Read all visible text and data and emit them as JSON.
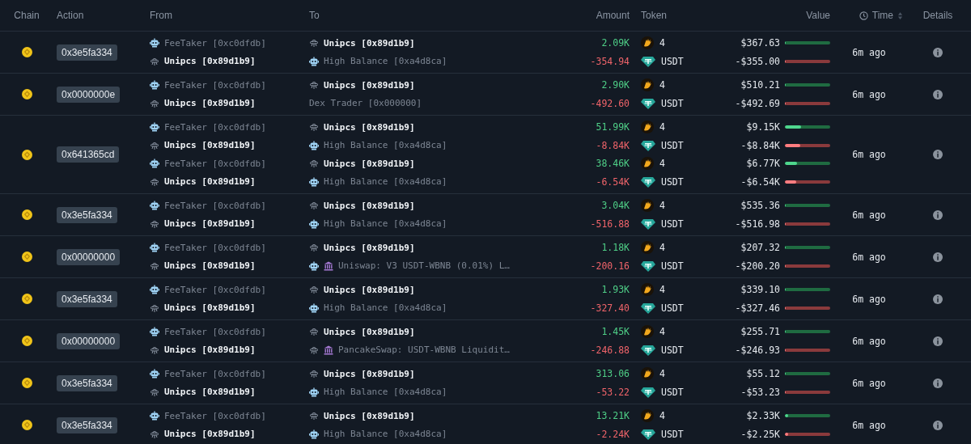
{
  "columns": [
    "Chain",
    "Action",
    "From",
    "To",
    "Amount",
    "Token",
    "Value",
    "Time",
    "Details"
  ],
  "rows": [
    {
      "action": "0x3e5fa334",
      "time": "6m ago",
      "transfers": [
        {
          "kind": "in",
          "from": {
            "kind": "bot",
            "contract": false,
            "highlight": false,
            "name": "FeeTaker [0xc0dfdb]"
          },
          "to": {
            "kind": "ufo",
            "contract": false,
            "highlight": true,
            "name": "Unipcs [0x89d1b9]"
          },
          "amount": "2.09K",
          "token": {
            "kind": "meme",
            "symbol": "4"
          },
          "value": "$367.63",
          "level": 0.01
        },
        {
          "kind": "out",
          "from": {
            "kind": "ufo",
            "contract": false,
            "highlight": true,
            "name": "Unipcs [0x89d1b9]"
          },
          "to": {
            "kind": "bot",
            "contract": false,
            "highlight": false,
            "name": "High Balance [0xa4d8ca]"
          },
          "amount": "-354.94",
          "token": {
            "kind": "usdt",
            "symbol": "USDT"
          },
          "value": "-$355.00",
          "level": 0.01
        }
      ]
    },
    {
      "action": "0x0000000e",
      "time": "6m ago",
      "transfers": [
        {
          "kind": "in",
          "from": {
            "kind": "bot",
            "contract": false,
            "highlight": false,
            "name": "FeeTaker [0xc0dfdb]"
          },
          "to": {
            "kind": "ufo",
            "contract": false,
            "highlight": true,
            "name": "Unipcs [0x89d1b9]"
          },
          "amount": "2.90K",
          "token": {
            "kind": "meme",
            "symbol": "4"
          },
          "value": "$510.21",
          "level": 0.02
        },
        {
          "kind": "out",
          "from": {
            "kind": "ufo",
            "contract": false,
            "highlight": true,
            "name": "Unipcs [0x89d1b9]"
          },
          "to": {
            "kind": "plain",
            "contract": false,
            "highlight": false,
            "name": "Dex Trader [0x000000]"
          },
          "amount": "-492.60",
          "token": {
            "kind": "usdt",
            "symbol": "USDT"
          },
          "value": "-$492.69",
          "level": 0.02
        }
      ]
    },
    {
      "action": "0x641365cd",
      "time": "6m ago",
      "transfers": [
        {
          "kind": "in",
          "from": {
            "kind": "bot",
            "contract": false,
            "highlight": false,
            "name": "FeeTaker [0xc0dfdb]"
          },
          "to": {
            "kind": "ufo",
            "contract": false,
            "highlight": true,
            "name": "Unipcs [0x89d1b9]"
          },
          "amount": "51.99K",
          "token": {
            "kind": "meme",
            "symbol": "4"
          },
          "value": "$9.15K",
          "level": 0.35
        },
        {
          "kind": "out",
          "from": {
            "kind": "ufo",
            "contract": false,
            "highlight": true,
            "name": "Unipcs [0x89d1b9]"
          },
          "to": {
            "kind": "bot",
            "contract": false,
            "highlight": false,
            "name": "High Balance [0xa4d8ca]"
          },
          "amount": "-8.84K",
          "token": {
            "kind": "usdt",
            "symbol": "USDT"
          },
          "value": "-$8.84K",
          "level": 0.34
        },
        {
          "kind": "in",
          "from": {
            "kind": "bot",
            "contract": false,
            "highlight": false,
            "name": "FeeTaker [0xc0dfdb]"
          },
          "to": {
            "kind": "ufo",
            "contract": false,
            "highlight": true,
            "name": "Unipcs [0x89d1b9]"
          },
          "amount": "38.46K",
          "token": {
            "kind": "meme",
            "symbol": "4"
          },
          "value": "$6.77K",
          "level": 0.26
        },
        {
          "kind": "out",
          "from": {
            "kind": "ufo",
            "contract": false,
            "highlight": true,
            "name": "Unipcs [0x89d1b9]"
          },
          "to": {
            "kind": "bot",
            "contract": false,
            "highlight": false,
            "name": "High Balance [0xa4d8ca]"
          },
          "amount": "-6.54K",
          "token": {
            "kind": "usdt",
            "symbol": "USDT"
          },
          "value": "-$6.54K",
          "level": 0.25
        }
      ]
    },
    {
      "action": "0x3e5fa334",
      "time": "6m ago",
      "transfers": [
        {
          "kind": "in",
          "from": {
            "kind": "bot",
            "contract": false,
            "highlight": false,
            "name": "FeeTaker [0xc0dfdb]"
          },
          "to": {
            "kind": "ufo",
            "contract": false,
            "highlight": true,
            "name": "Unipcs [0x89d1b9]"
          },
          "amount": "3.04K",
          "token": {
            "kind": "meme",
            "symbol": "4"
          },
          "value": "$535.36",
          "level": 0.02
        },
        {
          "kind": "out",
          "from": {
            "kind": "ufo",
            "contract": false,
            "highlight": true,
            "name": "Unipcs [0x89d1b9]"
          },
          "to": {
            "kind": "bot",
            "contract": false,
            "highlight": false,
            "name": "High Balance [0xa4d8ca]"
          },
          "amount": "-516.88",
          "token": {
            "kind": "usdt",
            "symbol": "USDT"
          },
          "value": "-$516.98",
          "level": 0.02
        }
      ]
    },
    {
      "action": "0x00000000",
      "time": "6m ago",
      "transfers": [
        {
          "kind": "in",
          "from": {
            "kind": "bot",
            "contract": false,
            "highlight": false,
            "name": "FeeTaker [0xc0dfdb]"
          },
          "to": {
            "kind": "ufo",
            "contract": false,
            "highlight": true,
            "name": "Unipcs [0x89d1b9]"
          },
          "amount": "1.18K",
          "token": {
            "kind": "meme",
            "symbol": "4"
          },
          "value": "$207.32",
          "level": 0.01
        },
        {
          "kind": "out",
          "from": {
            "kind": "ufo",
            "contract": false,
            "highlight": true,
            "name": "Unipcs [0x89d1b9]"
          },
          "to": {
            "kind": "bot",
            "contract": true,
            "highlight": false,
            "name": "Uniswap: V3 USDT-WBNB (0.01%) L…"
          },
          "amount": "-200.16",
          "token": {
            "kind": "usdt",
            "symbol": "USDT"
          },
          "value": "-$200.20",
          "level": 0.01
        }
      ]
    },
    {
      "action": "0x3e5fa334",
      "time": "6m ago",
      "transfers": [
        {
          "kind": "in",
          "from": {
            "kind": "bot",
            "contract": false,
            "highlight": false,
            "name": "FeeTaker [0xc0dfdb]"
          },
          "to": {
            "kind": "ufo",
            "contract": false,
            "highlight": true,
            "name": "Unipcs [0x89d1b9]"
          },
          "amount": "1.93K",
          "token": {
            "kind": "meme",
            "symbol": "4"
          },
          "value": "$339.10",
          "level": 0.01
        },
        {
          "kind": "out",
          "from": {
            "kind": "ufo",
            "contract": false,
            "highlight": true,
            "name": "Unipcs [0x89d1b9]"
          },
          "to": {
            "kind": "bot",
            "contract": false,
            "highlight": false,
            "name": "High Balance [0xa4d8ca]"
          },
          "amount": "-327.40",
          "token": {
            "kind": "usdt",
            "symbol": "USDT"
          },
          "value": "-$327.46",
          "level": 0.01
        }
      ]
    },
    {
      "action": "0x00000000",
      "time": "6m ago",
      "transfers": [
        {
          "kind": "in",
          "from": {
            "kind": "bot",
            "contract": false,
            "highlight": false,
            "name": "FeeTaker [0xc0dfdb]"
          },
          "to": {
            "kind": "ufo",
            "contract": false,
            "highlight": true,
            "name": "Unipcs [0x89d1b9]"
          },
          "amount": "1.45K",
          "token": {
            "kind": "meme",
            "symbol": "4"
          },
          "value": "$255.71",
          "level": 0.01
        },
        {
          "kind": "out",
          "from": {
            "kind": "ufo",
            "contract": false,
            "highlight": true,
            "name": "Unipcs [0x89d1b9]"
          },
          "to": {
            "kind": "ufo",
            "contract": true,
            "highlight": false,
            "name": "PancakeSwap: USDT-WBNB Liquidit…"
          },
          "amount": "-246.88",
          "token": {
            "kind": "usdt",
            "symbol": "USDT"
          },
          "value": "-$246.93",
          "level": 0.01
        }
      ]
    },
    {
      "action": "0x3e5fa334",
      "time": "6m ago",
      "transfers": [
        {
          "kind": "in",
          "from": {
            "kind": "bot",
            "contract": false,
            "highlight": false,
            "name": "FeeTaker [0xc0dfdb]"
          },
          "to": {
            "kind": "ufo",
            "contract": false,
            "highlight": true,
            "name": "Unipcs [0x89d1b9]"
          },
          "amount": "313.06",
          "token": {
            "kind": "meme",
            "symbol": "4"
          },
          "value": "$55.12",
          "level": 0.005
        },
        {
          "kind": "out",
          "from": {
            "kind": "ufo",
            "contract": false,
            "highlight": true,
            "name": "Unipcs [0x89d1b9]"
          },
          "to": {
            "kind": "bot",
            "contract": false,
            "highlight": false,
            "name": "High Balance [0xa4d8ca]"
          },
          "amount": "-53.22",
          "token": {
            "kind": "usdt",
            "symbol": "USDT"
          },
          "value": "-$53.23",
          "level": 0.005
        }
      ]
    },
    {
      "action": "0x3e5fa334",
      "time": "6m ago",
      "transfers": [
        {
          "kind": "in",
          "from": {
            "kind": "bot",
            "contract": false,
            "highlight": false,
            "name": "FeeTaker [0xc0dfdb]"
          },
          "to": {
            "kind": "ufo",
            "contract": false,
            "highlight": true,
            "name": "Unipcs [0x89d1b9]"
          },
          "amount": "13.21K",
          "token": {
            "kind": "meme",
            "symbol": "4"
          },
          "value": "$2.33K",
          "level": 0.08
        },
        {
          "kind": "out",
          "from": {
            "kind": "ufo",
            "contract": false,
            "highlight": true,
            "name": "Unipcs [0x89d1b9]"
          },
          "to": {
            "kind": "bot",
            "contract": false,
            "highlight": false,
            "name": "High Balance [0xa4d8ca]"
          },
          "amount": "-2.24K",
          "token": {
            "kind": "usdt",
            "symbol": "USDT"
          },
          "value": "-$2.25K",
          "level": 0.08
        }
      ]
    }
  ]
}
